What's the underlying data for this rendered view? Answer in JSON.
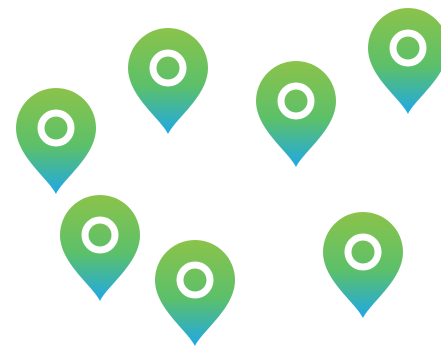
{
  "pins": [
    {
      "icon": "map-pin-icon"
    },
    {
      "icon": "map-pin-icon"
    },
    {
      "icon": "map-pin-icon"
    },
    {
      "icon": "map-pin-icon"
    },
    {
      "icon": "map-pin-icon"
    },
    {
      "icon": "map-pin-icon"
    },
    {
      "icon": "map-pin-icon"
    }
  ],
  "colors": {
    "pin_top": "#8BC34A",
    "pin_mid": "#5CC06A",
    "pin_bottom": "#1FA8E6",
    "ring": "#ffffff",
    "background": "#ffffff"
  }
}
